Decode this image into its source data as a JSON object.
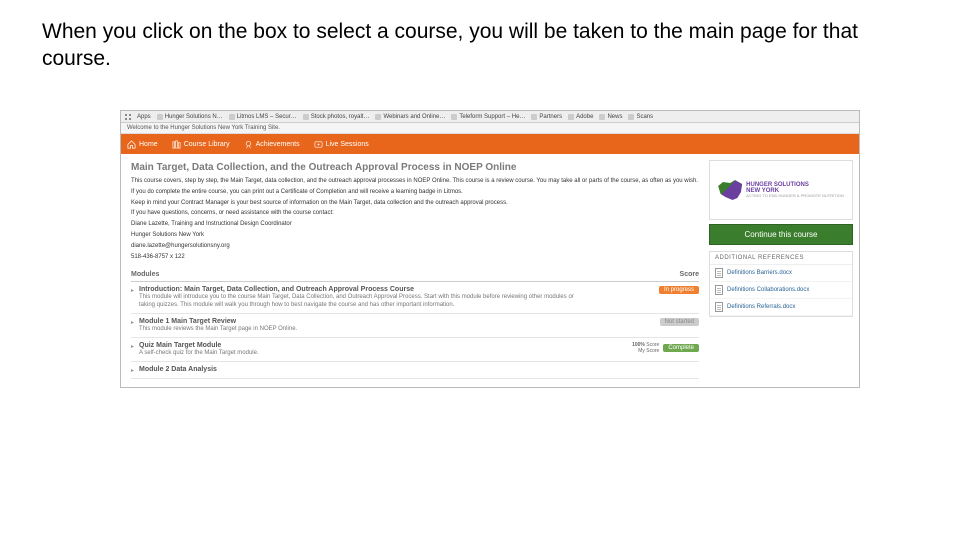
{
  "slide_text": "When you click on the box to select a course, you will be taken to the main page for that course.",
  "bookmarks": [
    {
      "label": "Apps"
    },
    {
      "label": "Hunger Solutions N…"
    },
    {
      "label": "Litmos LMS – Secur…"
    },
    {
      "label": "Stock photos, royalt…"
    },
    {
      "label": "Webinars and Online…"
    },
    {
      "label": "Teleform Support – He…"
    },
    {
      "label": "Partners"
    },
    {
      "label": "Adobe"
    },
    {
      "label": "News"
    },
    {
      "label": "Scans"
    }
  ],
  "welcome_text": "Welcome to the Hunger Solutions New York Training Site.",
  "nav": [
    {
      "label": "Home",
      "icon": "home-icon"
    },
    {
      "label": "Course Library",
      "icon": "library-icon"
    },
    {
      "label": "Achievements",
      "icon": "achievements-icon"
    },
    {
      "label": "Live Sessions",
      "icon": "live-icon"
    }
  ],
  "course": {
    "title": "Main Target, Data Collection, and the Outreach Approval Process in NOEP Online",
    "p1": "This course covers, step by step, the Main Target, data collection, and the outreach approval processes in NOEP Online. This course is a review course. You may take all or parts of the course, as often as you wish.",
    "p2": "If you do complete the entire course, you can print out a Certificate of Completion and will receive a learning badge in Litmos.",
    "p3": "Keep in mind your Contract Manager is your best source of information on the Main Target, data collection and the outreach approval process.",
    "p4": "If you have questions, concerns, or need assistance with the course contact:",
    "p5": "Diane Lazette, Training and Instructional Design Coordinator",
    "p6": "Hunger Solutions New York",
    "p7": "diane.lazette@hungersolutionsny.org",
    "p8": "518-436-8757 x 122"
  },
  "modules_header": "Modules",
  "score_header": "Score",
  "modules": [
    {
      "title": "Introduction: Main Target, Data Collection, and Outreach Approval Process Course",
      "sub": "This module will introduce you to the course Main Target, Data Collection, and Outreach Approval Process. Start with this module before reviewing other modules or taking quizzes. This module will walk you through how to best navigate the course and has other important information.",
      "badge": "In progress",
      "badge_class": "orange"
    },
    {
      "title": "Module 1 Main Target Review",
      "sub": "This module reviews the Main Target page in NOEP Online.",
      "badge": "Not started",
      "badge_class": "grey"
    },
    {
      "title": "Quiz Main Target Module",
      "sub": "A self-check quiz for the Main Target module.",
      "badge": "Complete",
      "badge_class": "green",
      "score_pct": "100%",
      "score_detail": "Score",
      "score_label": "My Score"
    },
    {
      "title": "Module 2 Data Analysis",
      "sub": ""
    }
  ],
  "logo": {
    "brand1": "HUNGER SOLUTIONS",
    "brand2": "NEW YORK",
    "tag": "ACTING TO END HUNGER & PROMOTE NUTRITION"
  },
  "continue_label": "Continue this course",
  "references": {
    "header": "ADDITIONAL REFERENCES",
    "items": [
      "Definitions Barriers.docx",
      "Definitions Collaborations.docx",
      "Definitions Referrals.docx"
    ]
  }
}
